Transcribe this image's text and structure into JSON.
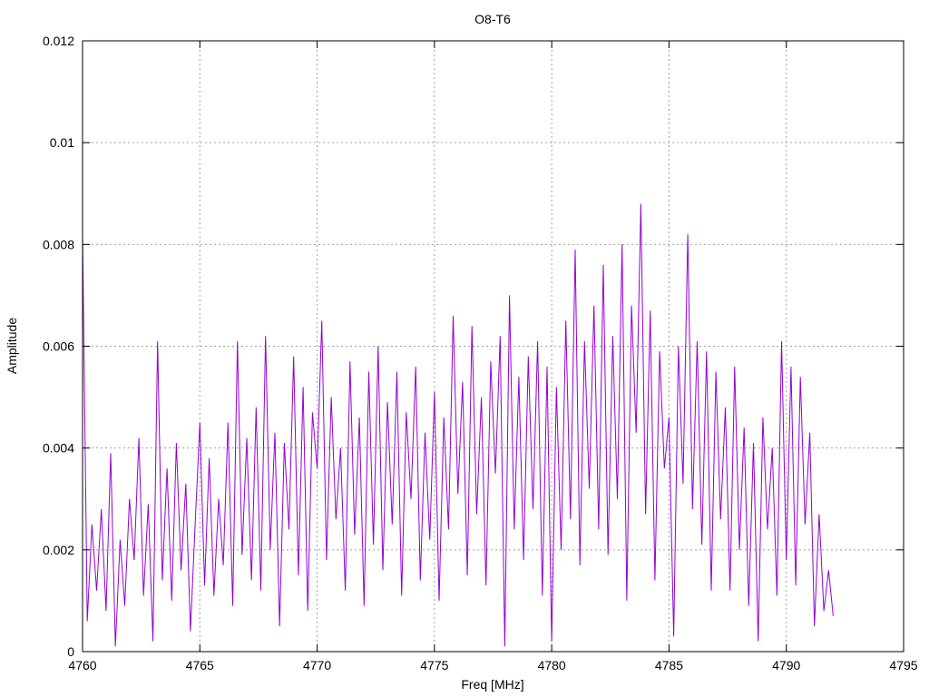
{
  "chart_data": {
    "type": "line",
    "title": "O8-T6",
    "xlabel": "Freq [MHz]",
    "ylabel": "Amplitude",
    "xlim": [
      4760,
      4795
    ],
    "ylim": [
      0,
      0.012
    ],
    "x_ticks": [
      "4760",
      "4765",
      "4770",
      "4775",
      "4780",
      "4785",
      "4790",
      "4795"
    ],
    "y_ticks": [
      "0",
      "0.002",
      "0.004",
      "0.006",
      "0.008",
      "0.01",
      "0.012"
    ],
    "grid": true,
    "legend": "none",
    "series": [
      {
        "color": "#9400d3",
        "x": [
          4760.0,
          4760.2,
          4760.4,
          4760.6,
          4760.8,
          4761.0,
          4761.2,
          4761.4,
          4761.6,
          4761.8,
          4762.0,
          4762.2,
          4762.4,
          4762.6,
          4762.8,
          4763.0,
          4763.2,
          4763.4,
          4763.6,
          4763.8,
          4764.0,
          4764.2,
          4764.4,
          4764.6,
          4764.8,
          4765.0,
          4765.2,
          4765.4,
          4765.6,
          4765.8,
          4766.0,
          4766.2,
          4766.4,
          4766.6,
          4766.8,
          4767.0,
          4767.2,
          4767.4,
          4767.6,
          4767.8,
          4768.0,
          4768.2,
          4768.4,
          4768.6,
          4768.8,
          4769.0,
          4769.2,
          4769.4,
          4769.6,
          4769.8,
          4770.0,
          4770.2,
          4770.4,
          4770.6,
          4770.8,
          4771.0,
          4771.2,
          4771.4,
          4771.6,
          4771.8,
          4772.0,
          4772.2,
          4772.4,
          4772.6,
          4772.8,
          4773.0,
          4773.2,
          4773.4,
          4773.6,
          4773.8,
          4774.0,
          4774.2,
          4774.4,
          4774.6,
          4774.8,
          4775.0,
          4775.2,
          4775.4,
          4775.6,
          4775.8,
          4776.0,
          4776.2,
          4776.4,
          4776.6,
          4776.8,
          4777.0,
          4777.2,
          4777.4,
          4777.6,
          4777.8,
          4778.0,
          4778.2,
          4778.4,
          4778.6,
          4778.8,
          4779.0,
          4779.2,
          4779.4,
          4779.6,
          4779.8,
          4780.0,
          4780.2,
          4780.4,
          4780.6,
          4780.8,
          4781.0,
          4781.2,
          4781.4,
          4781.6,
          4781.8,
          4782.0,
          4782.2,
          4782.4,
          4782.6,
          4782.8,
          4783.0,
          4783.2,
          4783.4,
          4783.6,
          4783.8,
          4784.0,
          4784.2,
          4784.4,
          4784.6,
          4784.8,
          4785.0,
          4785.2,
          4785.4,
          4785.6,
          4785.8,
          4786.0,
          4786.2,
          4786.4,
          4786.6,
          4786.8,
          4787.0,
          4787.2,
          4787.4,
          4787.6,
          4787.8,
          4788.0,
          4788.2,
          4788.4,
          4788.6,
          4788.8,
          4789.0,
          4789.2,
          4789.4,
          4789.6,
          4789.8,
          4790.0,
          4790.2,
          4790.4,
          4790.6,
          4790.8,
          4791.0,
          4791.2,
          4791.4,
          4791.6,
          4791.8,
          4792.0
        ],
        "y": [
          0.0082,
          0.0006,
          0.0025,
          0.0012,
          0.0028,
          0.0008,
          0.0039,
          0.0001,
          0.0022,
          0.0009,
          0.003,
          0.0018,
          0.0042,
          0.0011,
          0.0029,
          0.0002,
          0.0061,
          0.0014,
          0.0036,
          0.001,
          0.0041,
          0.0016,
          0.0033,
          0.0004,
          0.0025,
          0.0045,
          0.0013,
          0.0038,
          0.0011,
          0.003,
          0.0017,
          0.0045,
          0.0009,
          0.0061,
          0.0019,
          0.0042,
          0.0014,
          0.0048,
          0.0012,
          0.0062,
          0.002,
          0.0043,
          0.0005,
          0.0041,
          0.0024,
          0.0058,
          0.0015,
          0.0052,
          0.0008,
          0.0047,
          0.0036,
          0.0065,
          0.0018,
          0.005,
          0.0026,
          0.004,
          0.0012,
          0.0057,
          0.0023,
          0.0046,
          0.0009,
          0.0055,
          0.0021,
          0.006,
          0.0016,
          0.0049,
          0.0025,
          0.0055,
          0.0011,
          0.0047,
          0.003,
          0.0056,
          0.0014,
          0.0043,
          0.0022,
          0.0051,
          0.001,
          0.0046,
          0.0024,
          0.0066,
          0.0031,
          0.0053,
          0.0015,
          0.0064,
          0.0027,
          0.005,
          0.0013,
          0.0057,
          0.0035,
          0.0062,
          0.0001,
          0.007,
          0.0024,
          0.0054,
          0.0018,
          0.0058,
          0.0028,
          0.0061,
          0.0011,
          0.0056,
          0.0002,
          0.0052,
          0.002,
          0.0065,
          0.0026,
          0.0079,
          0.0017,
          0.0061,
          0.0032,
          0.0068,
          0.0024,
          0.0076,
          0.0019,
          0.0062,
          0.003,
          0.008,
          0.001,
          0.0068,
          0.0043,
          0.0088,
          0.0027,
          0.0067,
          0.0014,
          0.0059,
          0.0036,
          0.0046,
          0.0003,
          0.006,
          0.0033,
          0.0082,
          0.0028,
          0.0061,
          0.0021,
          0.0059,
          0.0012,
          0.0055,
          0.0026,
          0.0048,
          0.0012,
          0.0056,
          0.002,
          0.0044,
          0.0009,
          0.0041,
          0.0002,
          0.0046,
          0.0024,
          0.004,
          0.0011,
          0.0061,
          0.0018,
          0.0056,
          0.0013,
          0.0054,
          0.0025,
          0.0043,
          0.0005,
          0.0027,
          0.0008,
          0.0016,
          0.0007
        ]
      }
    ]
  }
}
